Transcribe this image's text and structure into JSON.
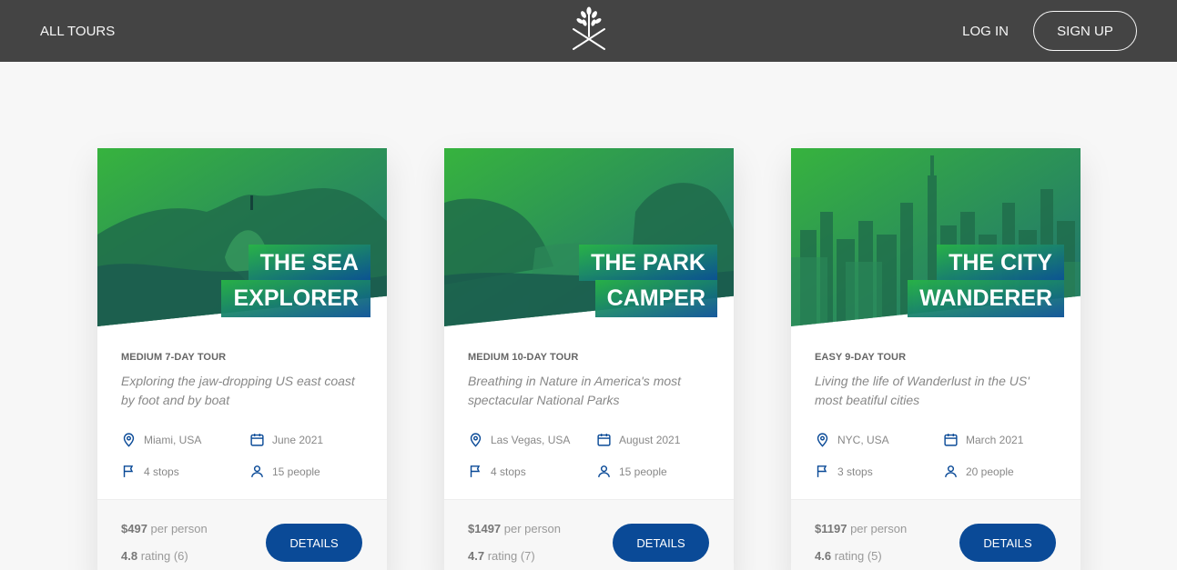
{
  "header": {
    "all_tours": "ALL TOURS",
    "login": "LOG IN",
    "signup": "SIGN UP",
    "logo_icon": "tree-logo-icon"
  },
  "colors": {
    "header_bg": "#444444",
    "accent_green": "#28b446",
    "accent_blue": "#0a4a97",
    "page_bg": "#f7f7f7"
  },
  "tours": [
    {
      "title_line1": "THE SEA",
      "title_line2": "EXPLORER",
      "subheading": "MEDIUM 7-DAY TOUR",
      "description": "Exploring the jaw-dropping US east coast by foot and by boat",
      "location": "Miami, USA",
      "date": "June 2021",
      "stops": "4 stops",
      "people": "15 people",
      "price": "$497",
      "price_suffix": "per person",
      "rating": "4.8",
      "rating_suffix": "rating (6)",
      "button": "DETAILS"
    },
    {
      "title_line1": "THE PARK",
      "title_line2": "CAMPER",
      "subheading": "MEDIUM 10-DAY TOUR",
      "description": "Breathing in Nature in America's most spectacular National Parks",
      "location": "Las Vegas, USA",
      "date": "August 2021",
      "stops": "4 stops",
      "people": "15 people",
      "price": "$1497",
      "price_suffix": "per person",
      "rating": "4.7",
      "rating_suffix": "rating (7)",
      "button": "DETAILS"
    },
    {
      "title_line1": "THE CITY",
      "title_line2": "WANDERER",
      "subheading": "EASY 9-DAY TOUR",
      "description": "Living the life of Wanderlust in the US' most beatiful cities",
      "location": "NYC, USA",
      "date": "March 2021",
      "stops": "3 stops",
      "people": "20 people",
      "price": "$1197",
      "price_suffix": "per person",
      "rating": "4.6",
      "rating_suffix": "rating (5)",
      "button": "DETAILS"
    }
  ]
}
